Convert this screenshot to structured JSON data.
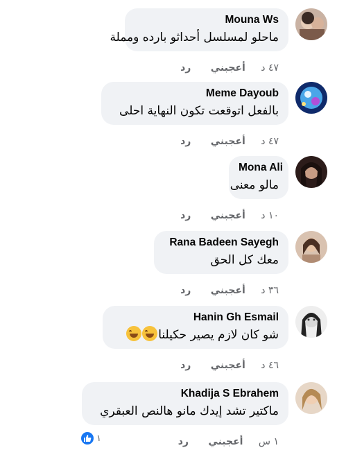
{
  "comments": [
    {
      "author": "Mouna Ws",
      "text": "ماحلو لمسلسل أحداثو بارده ومملة",
      "time": "٤٧ د",
      "like": "أعجبني",
      "reply": "رد"
    },
    {
      "author": "Meme Dayoub",
      "text": "بالفعل اتوقعت تكون النهاية احلى",
      "time": "٤٧ د",
      "like": "أعجبني",
      "reply": "رد"
    },
    {
      "author": "Mona Ali",
      "text": "مالو معنى",
      "time": "١٠ د",
      "like": "أعجبني",
      "reply": "رد"
    },
    {
      "author": "Rana Badeen Sayegh",
      "text": "معك كل الحق",
      "time": "٣٦ د",
      "like": "أعجبني",
      "reply": "رد"
    },
    {
      "author": "Hanin Gh Esmail",
      "text": "شو كان لازم يصير حكيلنا",
      "emoji": "grinning-sweat-emoji",
      "time": "٤٦ د",
      "like": "أعجبني",
      "reply": "رد"
    },
    {
      "author": "Khadija S Ebrahem",
      "text": "ماكتير تشد إيدك مانو هالنص العبقري",
      "time": "١ س",
      "like": "أعجبني",
      "reply": "رد",
      "reaction_count": "١"
    }
  ],
  "colors": {
    "bubble": "#f0f2f5",
    "meta": "#65676b",
    "like_badge": "#1877f2"
  },
  "icons": {
    "reaction": "thumbs-up-icon"
  }
}
